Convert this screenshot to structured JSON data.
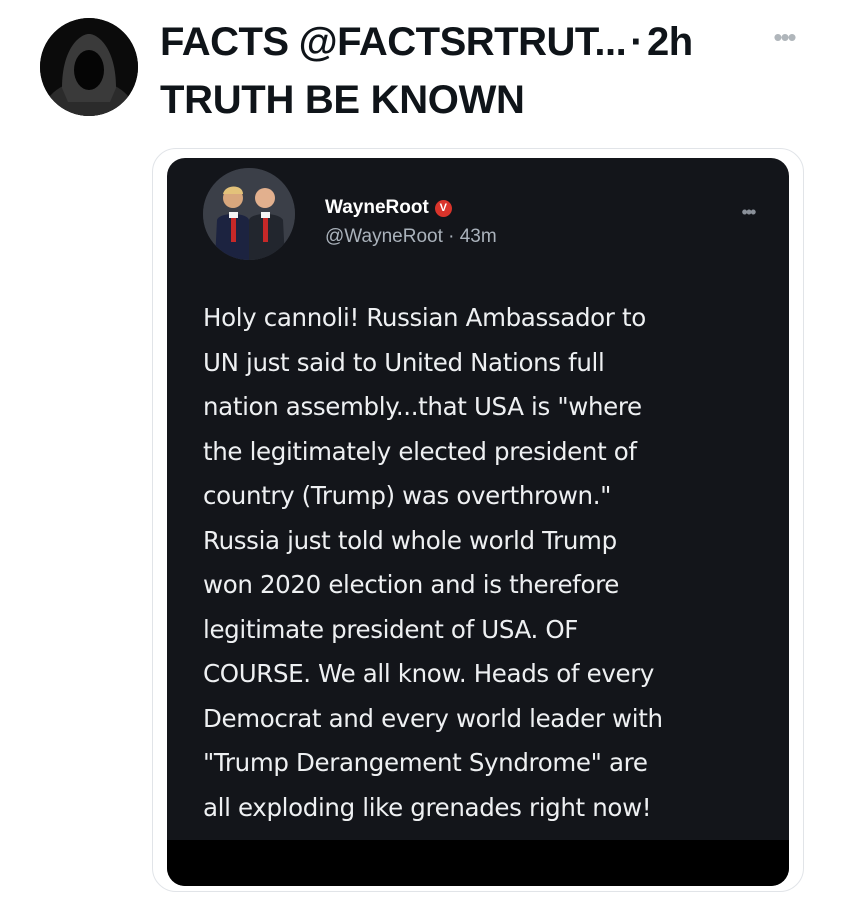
{
  "outer_tweet": {
    "author_name": "FACTS",
    "author_handle": "@FACTSRTRUT...",
    "separator": "·",
    "time": "2h",
    "more_icon": "more-horizontal-icon",
    "text": "TRUTH BE KNOWN"
  },
  "embedded_tweet": {
    "author_name": "WayneRoot",
    "verified_badge": "V",
    "handle_time": "@WayneRoot · 43m",
    "more_icon": "more-horizontal-icon",
    "body": "Holy cannoli! Russian Ambassador to\nUN just said to United Nations full\nnation assembly...that USA is \"where\nthe legitimately elected president of\ncountry (Trump) was overthrown.\"\nRussia just told whole world Trump\nwon 2020 election and is therefore\nlegitimate president of USA. OF\nCOURSE. We all know. Heads of every\nDemocrat and every world leader with\n\"Trump Derangement Syndrome\" are\nall exploding like grenades right now!"
  },
  "colors": {
    "page_background": "#ffffff",
    "text_primary": "#0f1419",
    "embedded_background": "#13151a",
    "embedded_text": "#eef0f2",
    "embedded_muted": "#aab2bb",
    "badge_red": "#d9342b"
  }
}
